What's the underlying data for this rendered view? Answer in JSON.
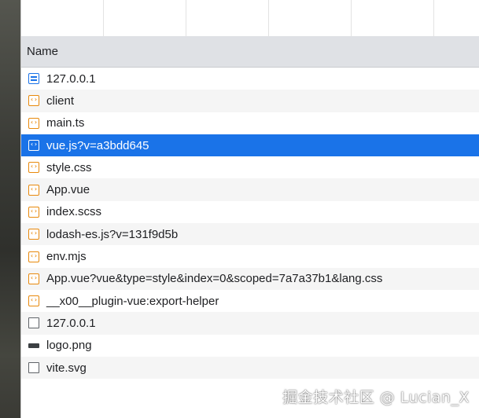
{
  "network": {
    "column_header": "Name",
    "rows": [
      {
        "name": "127.0.0.1",
        "icon": "document-icon",
        "selected": false
      },
      {
        "name": "client",
        "icon": "script-icon",
        "selected": false
      },
      {
        "name": "main.ts",
        "icon": "script-icon",
        "selected": false
      },
      {
        "name": "vue.js?v=a3bdd645",
        "icon": "script-icon",
        "selected": true
      },
      {
        "name": "style.css",
        "icon": "script-icon",
        "selected": false
      },
      {
        "name": "App.vue",
        "icon": "script-icon",
        "selected": false
      },
      {
        "name": "index.scss",
        "icon": "script-icon",
        "selected": false
      },
      {
        "name": "lodash-es.js?v=131f9d5b",
        "icon": "script-icon",
        "selected": false
      },
      {
        "name": "env.mjs",
        "icon": "script-icon",
        "selected": false
      },
      {
        "name": "App.vue?vue&type=style&index=0&scoped=7a7a37b1&lang.css",
        "icon": "script-icon",
        "selected": false
      },
      {
        "name": "__x00__plugin-vue:export-helper",
        "icon": "script-icon",
        "selected": false
      },
      {
        "name": "127.0.0.1",
        "icon": "blank-file-icon",
        "selected": false
      },
      {
        "name": "logo.png",
        "icon": "image-icon",
        "selected": false
      },
      {
        "name": "vite.svg",
        "icon": "blank-file-icon",
        "selected": false
      }
    ]
  },
  "watermark": "掘金技术社区 @ Lucian_X",
  "colors": {
    "selected_row": "#1a73e8",
    "script_icon": "#e8890c",
    "document_icon": "#1a73e8",
    "header_bg": "#dfe1e5"
  }
}
